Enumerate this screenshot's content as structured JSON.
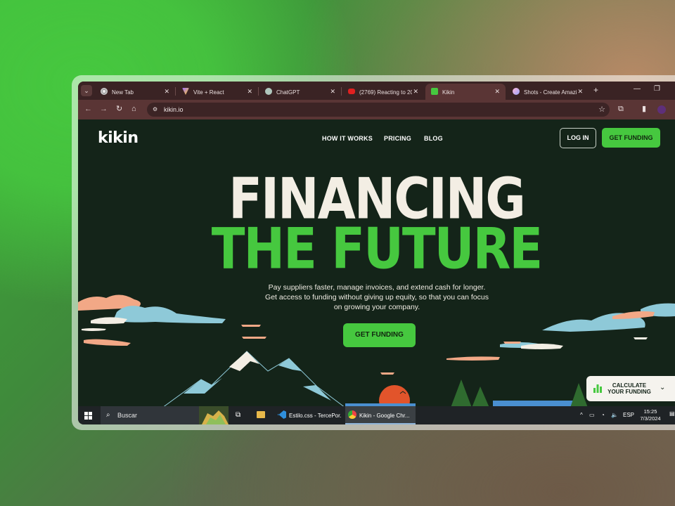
{
  "browser": {
    "tabs": [
      {
        "title": "New Tab",
        "icon": "chrome-icon",
        "active": false
      },
      {
        "title": "Vite + React",
        "icon": "vite-icon",
        "active": false
      },
      {
        "title": "ChatGPT",
        "icon": "chatgpt-icon",
        "active": false
      },
      {
        "title": "(2769) Reacting to 20",
        "icon": "youtube-icon",
        "active": false
      },
      {
        "title": "Kikin",
        "icon": "kikin-icon",
        "active": true
      },
      {
        "title": "Shots - Create Amazi",
        "icon": "shots-icon",
        "active": false
      }
    ],
    "close_glyph": "✕",
    "new_tab_glyph": "+",
    "url": "kikin.io"
  },
  "site": {
    "logo": "kikin",
    "nav": [
      "HOW IT WORKS",
      "PRICING",
      "BLOG"
    ],
    "login": "LOG IN",
    "get_funding_nav": "GET FUNDING",
    "headline_1": "FINANCING",
    "headline_2": "THE FUTURE",
    "subtitle_1": "Pay suppliers faster, manage invoices, and extend cash for longer.",
    "subtitle_2": "Get access to funding without giving up equity, so that you can focus",
    "subtitle_3": "on growing your company.",
    "cta": "GET FUNDING",
    "calc_line1": "CALCULATE",
    "calc_line2": "YOUR FUNDING",
    "colors": {
      "bg": "#142419",
      "accent": "#46c83f",
      "cream": "#f3eee4"
    }
  },
  "taskbar": {
    "search_placeholder": "Buscar",
    "apps": [
      {
        "label": "Estilo.css - TercePor...",
        "icon": "vscode-icon"
      },
      {
        "label": "Kikin - Google Chr...",
        "icon": "chrome-icon",
        "active": true
      }
    ],
    "lang": "ESP",
    "time": "15:25",
    "date": "7/3/2024"
  }
}
